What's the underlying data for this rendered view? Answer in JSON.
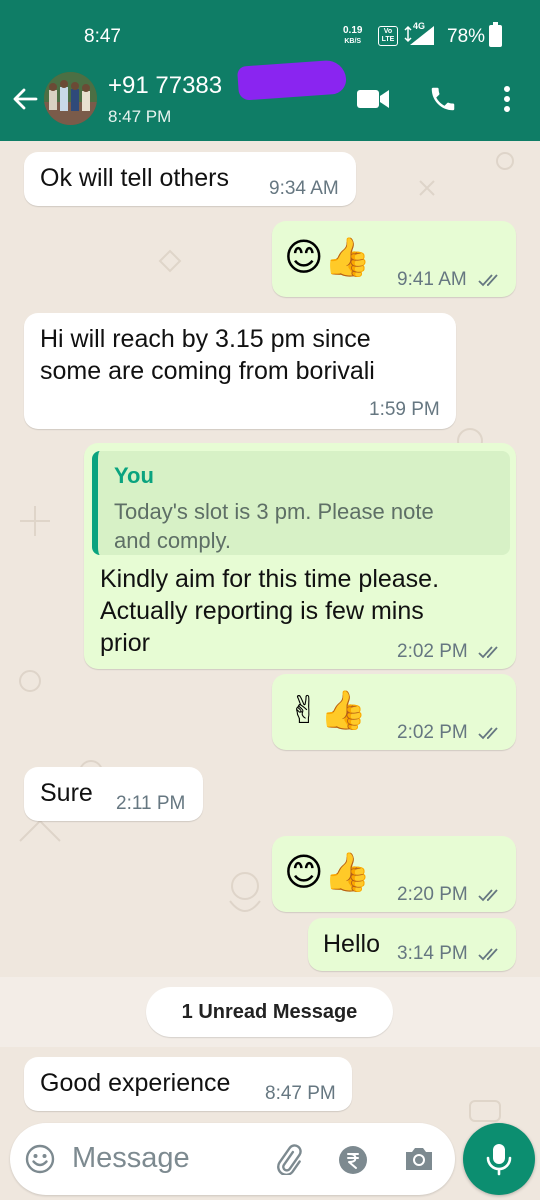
{
  "status_bar": {
    "time": "8:47",
    "speed_value": "0.19",
    "speed_unit": "KB/S",
    "volte_top": "Vo",
    "volte_bottom": "LTE",
    "network": "4G",
    "battery": "78%"
  },
  "header": {
    "contact_name": "+91 77383",
    "last_seen": "8:47 PM"
  },
  "messages": [
    {
      "direction": "in",
      "text": "Ok will tell others",
      "time": "9:34 AM"
    },
    {
      "direction": "out",
      "emoji": "😊👍",
      "time": "9:41 AM",
      "status": "read"
    },
    {
      "direction": "in",
      "lines": [
        "Hi will reach by 3.15 pm since",
        "some are coming from borivali"
      ],
      "time": "1:59 PM"
    },
    {
      "direction": "out",
      "quote": {
        "author": "You",
        "lines": [
          "Today's slot is 3 pm. Please note",
          "and comply."
        ]
      },
      "lines": [
        "Kindly aim for this time please.",
        "Actually reporting is few mins",
        "prior"
      ],
      "time": "2:02 PM",
      "status": "read"
    },
    {
      "direction": "out",
      "emoji": "✌👍",
      "time": "2:02 PM",
      "status": "read"
    },
    {
      "direction": "in",
      "text": "Sure",
      "time": "2:11 PM"
    },
    {
      "direction": "out",
      "emoji": "😊👍",
      "time": "2:20 PM",
      "status": "read"
    },
    {
      "direction": "out",
      "text": "Hello",
      "time": "3:14 PM",
      "status": "read"
    },
    {
      "divider": "1 Unread Message"
    },
    {
      "direction": "in",
      "text": "Good experience",
      "time": "8:47 PM"
    }
  ],
  "composer": {
    "placeholder": "Message"
  },
  "colors": {
    "header": "#0f7d66",
    "incoming_bubble": "#ffffff",
    "outgoing_bubble": "#e7fcd4",
    "mic_button": "#0c8e70",
    "quote_accent": "#0aa37f",
    "read_ticks": "#667781",
    "redaction": "#8a25f0"
  },
  "icons": [
    "back-arrow-icon",
    "video-call-icon",
    "phone-icon",
    "more-options-icon",
    "emoji-icon",
    "attach-icon",
    "rupee-icon",
    "camera-icon",
    "mic-icon",
    "double-tick-icon"
  ]
}
